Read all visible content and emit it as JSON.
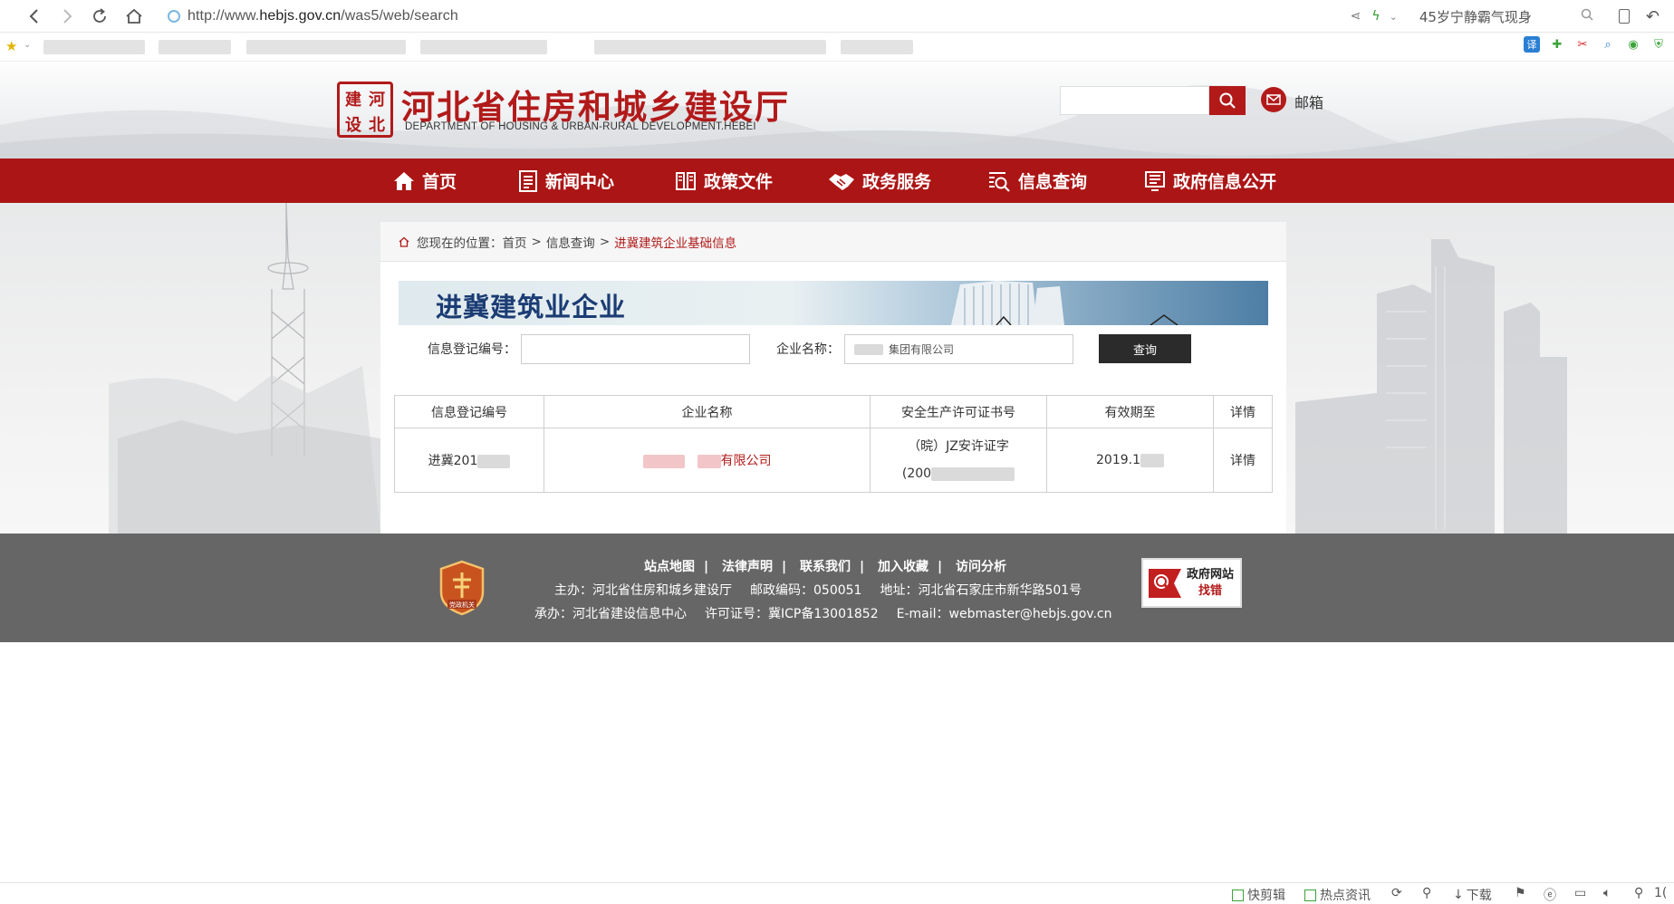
{
  "browser": {
    "url_prefix": "http://www.",
    "url_domain": "hebjs.gov.cn",
    "url_path": "/was5/web/search",
    "hot_search": "45岁宁静霸气现身"
  },
  "header": {
    "seal_chars": [
      "建",
      "河",
      "设",
      "北"
    ],
    "title": "河北省住房和城乡建设厅",
    "subtitle": "DEPARTMENT OF HOUSING & URBAN-RURAL DEVELOPMENT.HEBEI",
    "search_value": "",
    "mail_label": "邮箱"
  },
  "nav": {
    "items": [
      {
        "label": "首页",
        "icon": "home-icon"
      },
      {
        "label": "新闻中心",
        "icon": "news-icon"
      },
      {
        "label": "政策文件",
        "icon": "book-icon"
      },
      {
        "label": "政务服务",
        "icon": "handshake-icon"
      },
      {
        "label": "信息查询",
        "icon": "magnifier-list-icon"
      },
      {
        "label": "政府信息公开",
        "icon": "list-icon"
      }
    ]
  },
  "breadcrumb": {
    "prefix": "您现在的位置：",
    "items": [
      "首页",
      "信息查询"
    ],
    "separator": ">",
    "current": "进冀建筑企业基础信息"
  },
  "banner": {
    "title": "进冀建筑业企业"
  },
  "form": {
    "reg_label": "信息登记编号：",
    "reg_value": "",
    "name_label": "企业名称：",
    "name_value": "集团有限公司",
    "query_label": "查询"
  },
  "table": {
    "headers": [
      "信息登记编号",
      "企业名称",
      "安全生产许可证书号",
      "有效期至",
      "详情"
    ],
    "row": {
      "reg_no": "进冀201",
      "name": "有限公司",
      "license_line1": "（晥）JZ安许证字",
      "license_line2": "(200",
      "valid_until": "2019.1",
      "detail": "详情"
    }
  },
  "footer": {
    "links": [
      "站点地图",
      "法律声明",
      "联系我们",
      "加入收藏",
      "访问分析"
    ],
    "line1": [
      "主办：河北省住房和城乡建设厅",
      "邮政编码：050051",
      "地址：河北省石家庄市新华路501号"
    ],
    "line2": [
      "承办：河北省建设信息中心",
      "许可证号：冀ICP备13001852",
      "E-mail：webmaster@hebjs.gov.cn"
    ],
    "badge_text": "党政机关",
    "gov_error_line1": "政府网站",
    "gov_error_line2": "找错"
  },
  "statusbar": {
    "items": [
      "快剪辑",
      "热点资讯",
      "下载"
    ],
    "zoom": "1("
  },
  "colors": {
    "brand_red": "#ac1515",
    "footer_gray": "#666666",
    "banner_blue": "#1b3c74"
  }
}
